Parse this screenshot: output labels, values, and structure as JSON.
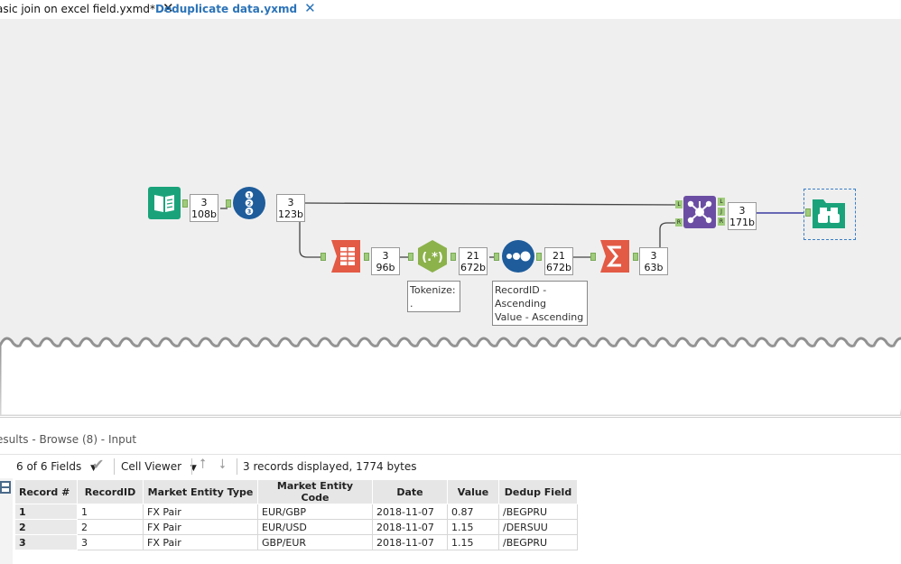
{
  "tabs": [
    {
      "label": "asic join on excel field.yxmd*",
      "close": "✕"
    },
    {
      "label": "Deduplicate data.yxmd",
      "close": "✕"
    }
  ],
  "workflow": {
    "counts": [
      {
        "records": "3",
        "bytes": "108b"
      },
      {
        "records": "3",
        "bytes": "123b"
      },
      {
        "records": "3",
        "bytes": "96b"
      },
      {
        "records": "21",
        "bytes": "672b"
      },
      {
        "records": "21",
        "bytes": "672b"
      },
      {
        "records": "3",
        "bytes": "63b"
      },
      {
        "records": "3",
        "bytes": "171b"
      }
    ],
    "regex_symbol": "(.*)",
    "record_id_digits": [
      "1",
      "2",
      "3"
    ],
    "join_anchor_labels": {
      "left": "L",
      "join": "J",
      "right": "R"
    },
    "annotations": {
      "tokenize": [
        "Tokenize:",
        "."
      ],
      "sort": [
        "RecordID -",
        "Ascending",
        "Value - Ascending"
      ]
    },
    "colors": {
      "canvas": "#efefef",
      "input_tool": "#1aa37a",
      "recordid_tool": "#1e5c9b",
      "regex_tool": "#8cb24b",
      "transform_tool": "#e35a45",
      "join_tool": "#6b4ea3",
      "browse_tool": "#1aa37a",
      "connection": "#444444",
      "anchor": "#9fcc7a"
    }
  },
  "results": {
    "title": "esults - Browse (8) - Input",
    "fields_label": "6 of 6 Fields",
    "cell_viewer_label": "Cell Viewer",
    "records_info": "3 records displayed, 1774 bytes",
    "columns": [
      "Record #",
      "RecordID",
      "Market Entity Type",
      "Market Entity Code",
      "Date",
      "Value",
      "Dedup Field"
    ],
    "rows": [
      [
        "1",
        "1",
        "FX Pair",
        "EUR/GBP",
        "2018-11-07",
        "0.87",
        "/BEGPRU"
      ],
      [
        "2",
        "2",
        "FX Pair",
        "EUR/USD",
        "2018-11-07",
        "1.15",
        "/DERSUU"
      ],
      [
        "3",
        "3",
        "FX Pair",
        "GBP/EUR",
        "2018-11-07",
        "1.15",
        "/BEGPRU"
      ]
    ]
  }
}
